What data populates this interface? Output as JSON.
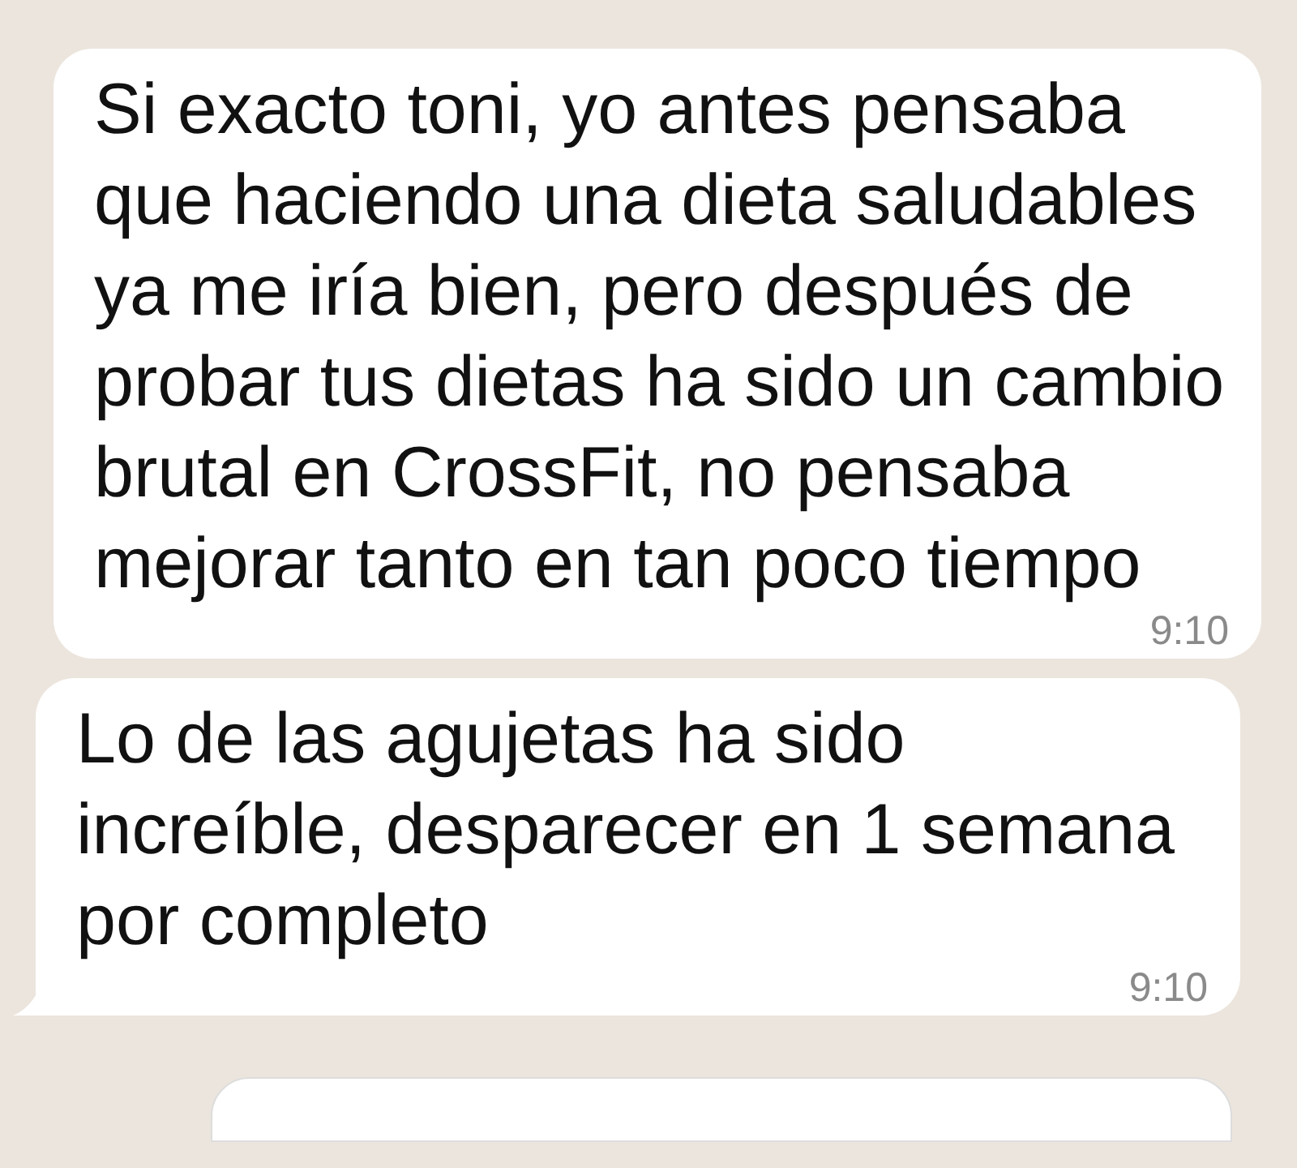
{
  "messages": [
    {
      "text": "Si exacto toni, yo antes pensaba que haciendo una dieta saludables ya me iría bien, pero después de probar tus dietas ha sido un cambio brutal en CrossFit, no pensaba mejorar tanto en tan poco tiempo",
      "time": "9:10",
      "tail": false
    },
    {
      "text": "Lo de las agujetas ha sido increíble, desparecer en 1 semana por completo",
      "time": "9:10",
      "tail": true
    }
  ]
}
